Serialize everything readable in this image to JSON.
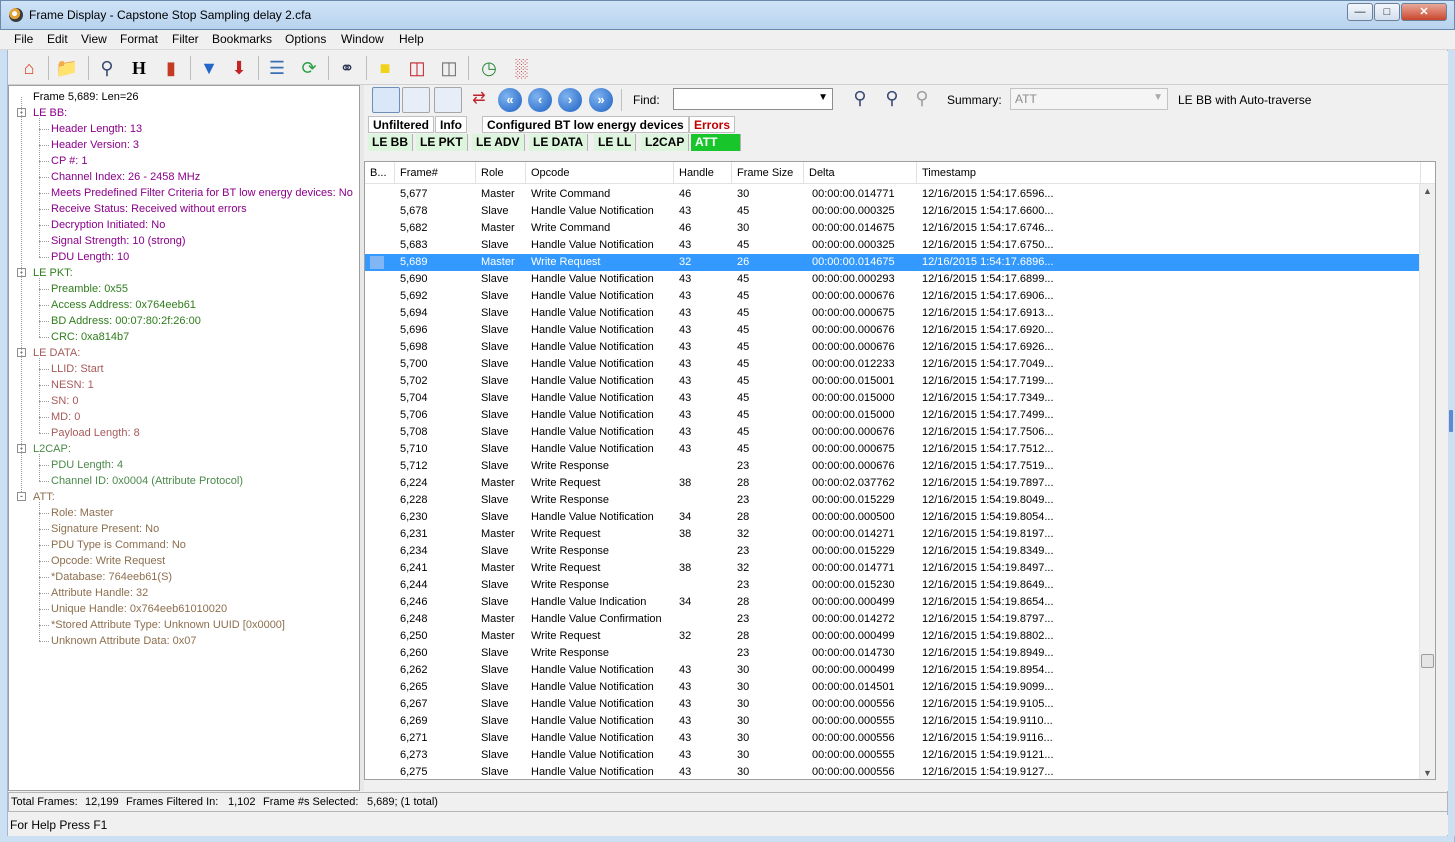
{
  "window": {
    "title": "Frame Display - Capstone Stop Sampling delay 2.cfa"
  },
  "menu": [
    "File",
    "Edit",
    "View",
    "Format",
    "Filter",
    "Bookmarks",
    "Options",
    "Window",
    "Help"
  ],
  "toolbar_icons": [
    "home-icon",
    "open-folder-icon",
    "search-icon",
    "h-icon",
    "bookmark-icon",
    "filter-icon",
    "filter-down-icon",
    "layers-icon",
    "refresh-icon",
    "binoculars-icon",
    "note-icon",
    "book-red-icon",
    "book-open-icon",
    "line-chart-icon",
    "bar-chart-icon"
  ],
  "tree": [
    {
      "text": "Frame 5,689:  Len=26",
      "level": 0,
      "color": "#000000",
      "toggle": null
    },
    {
      "text": "LE BB:",
      "level": 0,
      "color": "#8b008b",
      "toggle": "-"
    },
    {
      "text": "Header Length: 13",
      "level": 1,
      "color": "#8b008b"
    },
    {
      "text": "Header Version: 3",
      "level": 1,
      "color": "#8b008b"
    },
    {
      "text": "CP #: 1",
      "level": 1,
      "color": "#8b008b"
    },
    {
      "text": "Channel Index: 26 - 2458 MHz",
      "level": 1,
      "color": "#8b008b"
    },
    {
      "text": "Meets Predefined Filter Criteria for BT low energy devices: No",
      "level": 1,
      "color": "#8b008b"
    },
    {
      "text": "Receive Status: Received without errors",
      "level": 1,
      "color": "#8b008b"
    },
    {
      "text": "Decryption Initiated: No",
      "level": 1,
      "color": "#8b008b"
    },
    {
      "text": "Signal Strength: 10 (strong)",
      "level": 1,
      "color": "#8b008b"
    },
    {
      "text": "PDU Length: 10",
      "level": 1,
      "color": "#8b008b"
    },
    {
      "text": "LE PKT:",
      "level": 0,
      "color": "#2f7d1c",
      "toggle": "-"
    },
    {
      "text": "Preamble: 0x55",
      "level": 1,
      "color": "#2f7d1c"
    },
    {
      "text": "Access Address: 0x764eeb61",
      "level": 1,
      "color": "#2f7d1c"
    },
    {
      "text": "BD Address: 00:07:80:2f:26:00",
      "level": 1,
      "color": "#2f7d1c"
    },
    {
      "text": "CRC: 0xa814b7",
      "level": 1,
      "color": "#2f7d1c"
    },
    {
      "text": "LE DATA:",
      "level": 0,
      "color": "#a75a5a",
      "toggle": "-"
    },
    {
      "text": "LLID: Start",
      "level": 1,
      "color": "#a75a5a"
    },
    {
      "text": "NESN: 1",
      "level": 1,
      "color": "#a75a5a"
    },
    {
      "text": "SN: 0",
      "level": 1,
      "color": "#a75a5a"
    },
    {
      "text": "MD: 0",
      "level": 1,
      "color": "#a75a5a"
    },
    {
      "text": "Payload Length: 8",
      "level": 1,
      "color": "#a75a5a"
    },
    {
      "text": "L2CAP:",
      "level": 0,
      "color": "#4a8a4a",
      "toggle": "-"
    },
    {
      "text": "PDU Length: 4",
      "level": 1,
      "color": "#4a8a4a"
    },
    {
      "text": "Channel ID: 0x0004  (Attribute Protocol)",
      "level": 1,
      "color": "#4a8a4a"
    },
    {
      "text": "ATT:",
      "level": 0,
      "color": "#8d6f4f",
      "toggle": "-"
    },
    {
      "text": "Role: Master",
      "level": 1,
      "color": "#8d6f4f"
    },
    {
      "text": "Signature Present: No",
      "level": 1,
      "color": "#8d6f4f"
    },
    {
      "text": "PDU Type is Command: No",
      "level": 1,
      "color": "#8d6f4f"
    },
    {
      "text": "Opcode: Write Request",
      "level": 1,
      "color": "#8d6f4f"
    },
    {
      "text": "*Database: 764eeb61(S)",
      "level": 1,
      "color": "#8d6f4f"
    },
    {
      "text": "Attribute Handle: 32",
      "level": 1,
      "color": "#8d6f4f"
    },
    {
      "text": "Unique Handle: 0x764eeb61010020",
      "level": 1,
      "color": "#8d6f4f"
    },
    {
      "text": "*Stored Attribute Type: Unknown UUID [0x0000]",
      "level": 1,
      "color": "#8d6f4f"
    },
    {
      "text": "Unknown Attribute Data: 0x07",
      "level": 1,
      "color": "#8d6f4f"
    }
  ],
  "find_label": "Find:",
  "find_value": "",
  "summary_label": "Summary:",
  "summary_value": "ATT",
  "auto_traverse": "LE BB with Auto-traverse",
  "filter_tabs": [
    "Unfiltered",
    "Info",
    "Configured BT low energy devices",
    "Errors"
  ],
  "layer_tabs": [
    "LE BB",
    "LE PKT",
    "LE ADV",
    "LE DATA",
    "LE LL",
    "L2CAP",
    "ATT"
  ],
  "active_layer": "ATT",
  "columns": [
    "B...",
    "Frame#",
    "Role",
    "Opcode",
    "Handle",
    "Frame Size",
    "Delta",
    "Timestamp"
  ],
  "rows": [
    [
      "5,677",
      "Master",
      "Write Command",
      "46",
      "30",
      "00:00:00.014771",
      "12/16/2015 1:54:17.6596..."
    ],
    [
      "5,678",
      "Slave",
      "Handle Value Notification",
      "43",
      "45",
      "00:00:00.000325",
      "12/16/2015 1:54:17.6600..."
    ],
    [
      "5,682",
      "Master",
      "Write Command",
      "46",
      "30",
      "00:00:00.014675",
      "12/16/2015 1:54:17.6746..."
    ],
    [
      "5,683",
      "Slave",
      "Handle Value Notification",
      "43",
      "45",
      "00:00:00.000325",
      "12/16/2015 1:54:17.6750..."
    ],
    [
      "5,689",
      "Master",
      "Write Request",
      "32",
      "26",
      "00:00:00.014675",
      "12/16/2015 1:54:17.6896..."
    ],
    [
      "5,690",
      "Slave",
      "Handle Value Notification",
      "43",
      "45",
      "00:00:00.000293",
      "12/16/2015 1:54:17.6899..."
    ],
    [
      "5,692",
      "Slave",
      "Handle Value Notification",
      "43",
      "45",
      "00:00:00.000676",
      "12/16/2015 1:54:17.6906..."
    ],
    [
      "5,694",
      "Slave",
      "Handle Value Notification",
      "43",
      "45",
      "00:00:00.000675",
      "12/16/2015 1:54:17.6913..."
    ],
    [
      "5,696",
      "Slave",
      "Handle Value Notification",
      "43",
      "45",
      "00:00:00.000676",
      "12/16/2015 1:54:17.6920..."
    ],
    [
      "5,698",
      "Slave",
      "Handle Value Notification",
      "43",
      "45",
      "00:00:00.000676",
      "12/16/2015 1:54:17.6926..."
    ],
    [
      "5,700",
      "Slave",
      "Handle Value Notification",
      "43",
      "45",
      "00:00:00.012233",
      "12/16/2015 1:54:17.7049..."
    ],
    [
      "5,702",
      "Slave",
      "Handle Value Notification",
      "43",
      "45",
      "00:00:00.015001",
      "12/16/2015 1:54:17.7199..."
    ],
    [
      "5,704",
      "Slave",
      "Handle Value Notification",
      "43",
      "45",
      "00:00:00.015000",
      "12/16/2015 1:54:17.7349..."
    ],
    [
      "5,706",
      "Slave",
      "Handle Value Notification",
      "43",
      "45",
      "00:00:00.015000",
      "12/16/2015 1:54:17.7499..."
    ],
    [
      "5,708",
      "Slave",
      "Handle Value Notification",
      "43",
      "45",
      "00:00:00.000676",
      "12/16/2015 1:54:17.7506..."
    ],
    [
      "5,710",
      "Slave",
      "Handle Value Notification",
      "43",
      "45",
      "00:00:00.000675",
      "12/16/2015 1:54:17.7512..."
    ],
    [
      "5,712",
      "Slave",
      "Write Response",
      "",
      "23",
      "00:00:00.000676",
      "12/16/2015 1:54:17.7519..."
    ],
    [
      "6,224",
      "Master",
      "Write Request",
      "38",
      "28",
      "00:00:02.037762",
      "12/16/2015 1:54:19.7897..."
    ],
    [
      "6,228",
      "Slave",
      "Write Response",
      "",
      "23",
      "00:00:00.015229",
      "12/16/2015 1:54:19.8049..."
    ],
    [
      "6,230",
      "Slave",
      "Handle Value Notification",
      "34",
      "28",
      "00:00:00.000500",
      "12/16/2015 1:54:19.8054..."
    ],
    [
      "6,231",
      "Master",
      "Write Request",
      "38",
      "32",
      "00:00:00.014271",
      "12/16/2015 1:54:19.8197..."
    ],
    [
      "6,234",
      "Slave",
      "Write Response",
      "",
      "23",
      "00:00:00.015229",
      "12/16/2015 1:54:19.8349..."
    ],
    [
      "6,241",
      "Master",
      "Write Request",
      "38",
      "32",
      "00:00:00.014771",
      "12/16/2015 1:54:19.8497..."
    ],
    [
      "6,244",
      "Slave",
      "Write Response",
      "",
      "23",
      "00:00:00.015230",
      "12/16/2015 1:54:19.8649..."
    ],
    [
      "6,246",
      "Slave",
      "Handle Value Indication",
      "34",
      "28",
      "00:00:00.000499",
      "12/16/2015 1:54:19.8654..."
    ],
    [
      "6,248",
      "Master",
      "Handle Value Confirmation",
      "",
      "23",
      "00:00:00.014272",
      "12/16/2015 1:54:19.8797..."
    ],
    [
      "6,250",
      "Master",
      "Write Request",
      "32",
      "28",
      "00:00:00.000499",
      "12/16/2015 1:54:19.8802..."
    ],
    [
      "6,260",
      "Slave",
      "Write Response",
      "",
      "23",
      "00:00:00.014730",
      "12/16/2015 1:54:19.8949..."
    ],
    [
      "6,262",
      "Slave",
      "Handle Value Notification",
      "43",
      "30",
      "00:00:00.000499",
      "12/16/2015 1:54:19.8954..."
    ],
    [
      "6,265",
      "Slave",
      "Handle Value Notification",
      "43",
      "30",
      "00:00:00.014501",
      "12/16/2015 1:54:19.9099..."
    ],
    [
      "6,267",
      "Slave",
      "Handle Value Notification",
      "43",
      "30",
      "00:00:00.000556",
      "12/16/2015 1:54:19.9105..."
    ],
    [
      "6,269",
      "Slave",
      "Handle Value Notification",
      "43",
      "30",
      "00:00:00.000555",
      "12/16/2015 1:54:19.9110..."
    ],
    [
      "6,271",
      "Slave",
      "Handle Value Notification",
      "43",
      "30",
      "00:00:00.000556",
      "12/16/2015 1:54:19.9116..."
    ],
    [
      "6,273",
      "Slave",
      "Handle Value Notification",
      "43",
      "30",
      "00:00:00.000555",
      "12/16/2015 1:54:19.9121..."
    ],
    [
      "6,275",
      "Slave",
      "Handle Value Notification",
      "43",
      "30",
      "00:00:00.000556",
      "12/16/2015 1:54:19.9127..."
    ]
  ],
  "selected_frame": "5,689",
  "status": {
    "total_label": "Total Frames:",
    "total_value": "12,199",
    "filtered_label": "Frames Filtered In:",
    "filtered_value": "1,102",
    "selected_label": "Frame #s Selected:",
    "selected_value": "5,689; (1 total)",
    "help": "For Help Press F1"
  },
  "colors": {
    "selection": "#3399ff",
    "active_tab": "#18c62c",
    "errors_tab": "#c00000"
  }
}
